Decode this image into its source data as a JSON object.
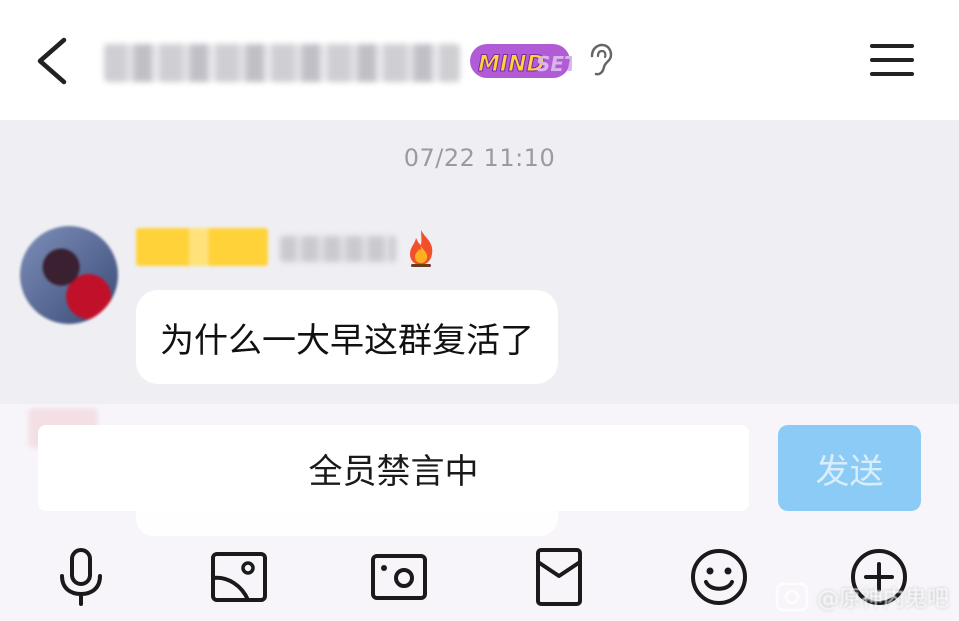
{
  "header": {
    "back_icon": "chevron-left-icon",
    "group_title": "",
    "badge_text": "MINDSET",
    "ear_icon": "ear-icon",
    "menu_icon": "hamburger-menu-icon"
  },
  "chat": {
    "timestamp": "07/22 11:10",
    "messages": [
      {
        "sender_name": "",
        "sender_icon": "fire-icon",
        "text": "为什么一大早这群复活了"
      }
    ]
  },
  "input": {
    "placeholder": "全员禁言中",
    "send_label": "发送"
  },
  "toolbar": {
    "items": [
      {
        "icon": "microphone-icon"
      },
      {
        "icon": "image-icon"
      },
      {
        "icon": "camera-icon"
      },
      {
        "icon": "red-envelope-icon"
      },
      {
        "icon": "emoji-icon"
      },
      {
        "icon": "plus-circle-icon"
      }
    ]
  },
  "watermark": {
    "text": "@原神内鬼吧"
  },
  "colors": {
    "send_button_bg": "#8ccbf6",
    "chat_bg": "#efeff3",
    "header_bg": "#ffffff"
  }
}
